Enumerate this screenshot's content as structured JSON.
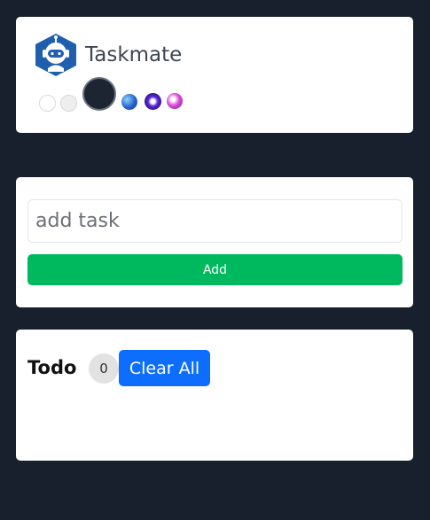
{
  "header": {
    "app_name": "Taskmate",
    "logo_icon": "astronaut-robot-hex-icon",
    "theme_swatches": [
      {
        "name": "light",
        "color": "#ffffff"
      },
      {
        "name": "light-gray",
        "color": "#eeeeee"
      },
      {
        "name": "dark",
        "color": "#1d2532",
        "selected": true
      },
      {
        "name": "blue",
        "color": "#2563c9"
      },
      {
        "name": "purple",
        "color": "#5b2bd8"
      },
      {
        "name": "pink",
        "color": "#e04bd6"
      }
    ]
  },
  "add_task": {
    "placeholder": "add task",
    "value": "",
    "button_label": "Add"
  },
  "todo": {
    "title": "Todo",
    "count": "0",
    "clear_label": "Clear All",
    "items": []
  },
  "colors": {
    "background": "#17202c",
    "add_button": "#00b95e",
    "clear_button": "#0d6efd",
    "logo": "#1f5fae"
  }
}
